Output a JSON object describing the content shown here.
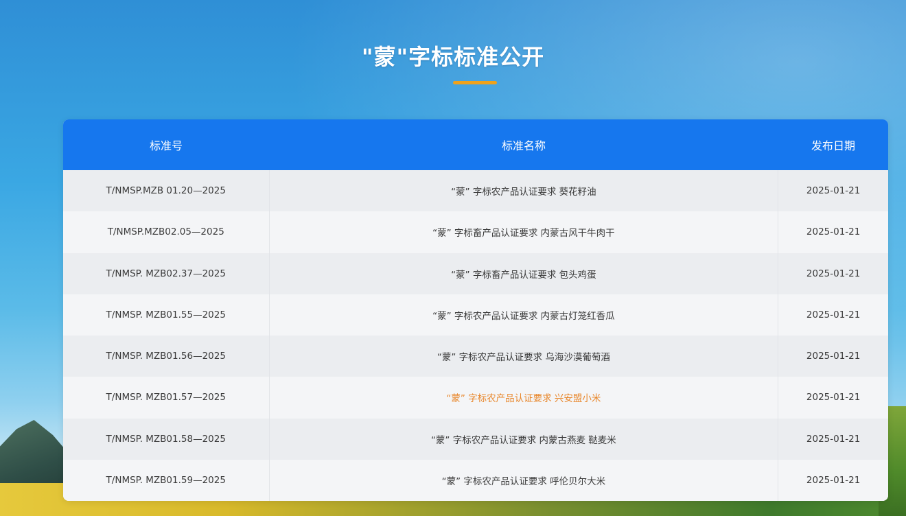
{
  "page": {
    "title": "\"蒙\"字标标准公开",
    "accent_color": "#f0a21c",
    "header_color": "#1677ee"
  },
  "table": {
    "headers": [
      "标准号",
      "标准名称",
      "发布日期"
    ],
    "rows": [
      {
        "code": "T/NMSP.MZB 01.20—2025",
        "name": "“蒙” 字标农产品认证要求 葵花籽油",
        "date": "2025-01-21"
      },
      {
        "code": "T/NMSP.MZB02.05—2025",
        "name": "“蒙” 字标畜产品认证要求 内蒙古风干牛肉干",
        "date": "2025-01-21"
      },
      {
        "code": "T/NMSP. MZB02.37—2025",
        "name": "“蒙” 字标畜产品认证要求 包头鸡蛋",
        "date": "2025-01-21"
      },
      {
        "code": "T/NMSP. MZB01.55—2025",
        "name": "“蒙” 字标农产品认证要求 内蒙古灯笼红香瓜",
        "date": "2025-01-21"
      },
      {
        "code": "T/NMSP. MZB01.56—2025",
        "name": "“蒙” 字标农产品认证要求 乌海沙漠葡萄酒",
        "date": "2025-01-21"
      },
      {
        "code": "T/NMSP. MZB01.57—2025",
        "name": "“蒙” 字标农产品认证要求 兴安盟小米",
        "date": "2025-01-21",
        "highlight": true
      },
      {
        "code": "T/NMSP. MZB01.58—2025",
        "name": "“蒙” 字标农产品认证要求 内蒙古燕麦 鞑麦米",
        "date": "2025-01-21"
      },
      {
        "code": "T/NMSP. MZB01.59—2025",
        "name": "“蒙” 字标农产品认证要求 呼伦贝尔大米",
        "date": "2025-01-21"
      }
    ]
  }
}
